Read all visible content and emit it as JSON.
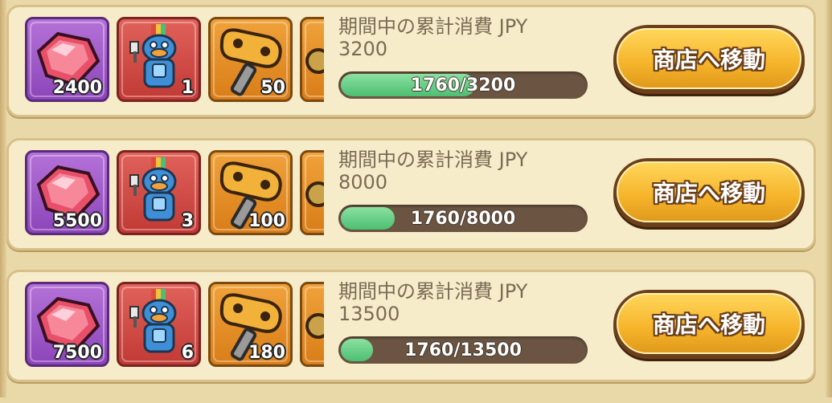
{
  "tiers": [
    {
      "label": "期間中の累計消費 JPY",
      "target": "3200",
      "progress_text": "1760/3200",
      "progress_fraction": 0.55,
      "rewards": [
        {
          "icon": "gem-icon",
          "qty": "2400"
        },
        {
          "icon": "hero-character-icon",
          "qty": "1"
        },
        {
          "icon": "wind-up-key-icon",
          "qty": "50"
        },
        {
          "icon": "partial-item-icon",
          "qty": ""
        }
      ],
      "button_label": "商店へ移動"
    },
    {
      "label": "期間中の累計消費 JPY",
      "target": "8000",
      "progress_text": "1760/8000",
      "progress_fraction": 0.22,
      "rewards": [
        {
          "icon": "gem-icon",
          "qty": "5500"
        },
        {
          "icon": "hero-character-icon",
          "qty": "3"
        },
        {
          "icon": "wind-up-key-icon",
          "qty": "100"
        },
        {
          "icon": "partial-item-icon",
          "qty": ""
        }
      ],
      "button_label": "商店へ移動"
    },
    {
      "label": "期間中の累計消費 JPY",
      "target": "13500",
      "progress_text": "1760/13500",
      "progress_fraction": 0.13,
      "rewards": [
        {
          "icon": "gem-icon",
          "qty": "7500"
        },
        {
          "icon": "hero-character-icon",
          "qty": "6"
        },
        {
          "icon": "wind-up-key-icon",
          "qty": "180"
        },
        {
          "icon": "partial-item-icon",
          "qty": ""
        }
      ],
      "button_label": "商店へ移動"
    }
  ],
  "colors": {
    "background": "#e9d8a8",
    "card": "#f6ecc9",
    "progress_fill": "#4cbf72",
    "progress_track": "#6b5542",
    "button": "#f5b32a"
  }
}
